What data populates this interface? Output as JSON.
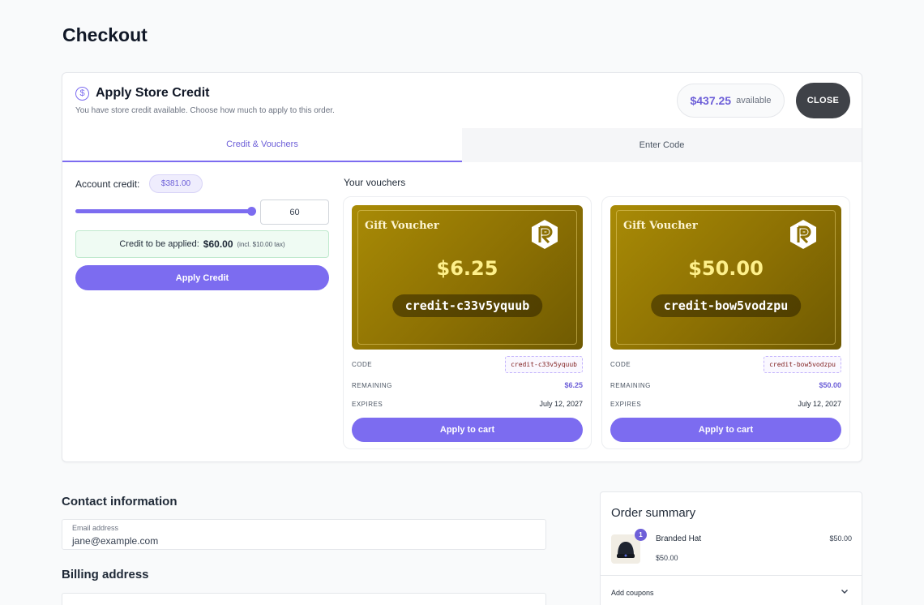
{
  "page": {
    "title": "Checkout"
  },
  "credit_panel": {
    "title": "Apply Store Credit",
    "subtitle": "You have store credit available. Choose how much to apply to this order.",
    "available_amount": "$437.25",
    "available_label": "available",
    "close_label": "CLOSE",
    "tabs": [
      {
        "label": "Credit & Vouchers",
        "active": true
      },
      {
        "label": "Enter Code",
        "active": false
      }
    ],
    "account": {
      "label": "Account credit:",
      "balance": "$381.00",
      "slider_fraction": 1.0,
      "amount_value": "60",
      "applied_label": "Credit to be applied:",
      "applied_amount": "$60.00",
      "applied_tax": "(incl. $10.00 tax)",
      "apply_button": "Apply Credit"
    },
    "vouchers_title": "Your vouchers",
    "vouchers": [
      {
        "kind": "Gift Voucher",
        "amount": "$6.25",
        "code": "credit-c33v5yquub",
        "code_key": "CODE",
        "remaining_key": "REMAINING",
        "remaining": "$6.25",
        "expires_key": "EXPIRES",
        "expires": "July 12, 2027",
        "button": "Apply to cart"
      },
      {
        "kind": "Gift Voucher",
        "amount": "$50.00",
        "code": "credit-bow5vodzpu",
        "code_key": "CODE",
        "remaining_key": "REMAINING",
        "remaining": "$50.00",
        "expires_key": "EXPIRES",
        "expires": "July 12, 2027",
        "button": "Apply to cart"
      }
    ]
  },
  "contact": {
    "title": "Contact information",
    "email_label": "Email address",
    "email_value": "jane@example.com"
  },
  "billing": {
    "title": "Billing address"
  },
  "summary": {
    "title": "Order summary",
    "item": {
      "name": "Branded Hat",
      "unit_price": "$50.00",
      "price": "$50.00",
      "qty": "1"
    },
    "coupons_label": "Add coupons"
  },
  "colors": {
    "accent": "#7c6cf0",
    "accent_text": "#6d5fd8",
    "voucher_gold": "#a98b06",
    "close_button": "#3f4248"
  }
}
